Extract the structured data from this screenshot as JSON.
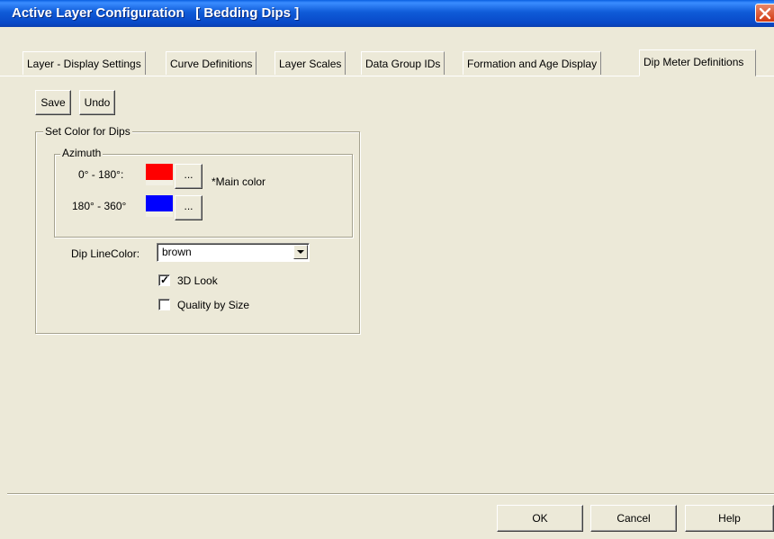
{
  "window": {
    "title": "Active Layer Configuration   [ Bedding Dips ]"
  },
  "tabs": [
    {
      "label": "Layer - Display Settings"
    },
    {
      "label": "Curve Definitions"
    },
    {
      "label": "Layer Scales"
    },
    {
      "label": "Data Group IDs"
    },
    {
      "label": "Formation and Age Display"
    },
    {
      "label": "Dip Meter Definitions",
      "active": true
    }
  ],
  "toolbar": {
    "save_label": "Save",
    "undo_label": "Undo"
  },
  "dips": {
    "group_label": "Set Color for Dips",
    "azimuth": {
      "group_label": "Azimuth",
      "range1_label": "0° - 180°:",
      "range1_color": "#FF0000",
      "range1_button": "...",
      "main_color_note": "*Main color",
      "range2_label": "180° - 360°",
      "range2_color": "#0000FF",
      "range2_button": "..."
    },
    "dip_line_color_label": "Dip LineColor:",
    "dip_line_color_value": "brown",
    "look3d_label": "3D Look",
    "look3d_checked": true,
    "quality_label": "Quality by Size",
    "quality_checked": false
  },
  "footer": {
    "ok_label": "OK",
    "cancel_label": "Cancel",
    "help_label": "Help"
  }
}
